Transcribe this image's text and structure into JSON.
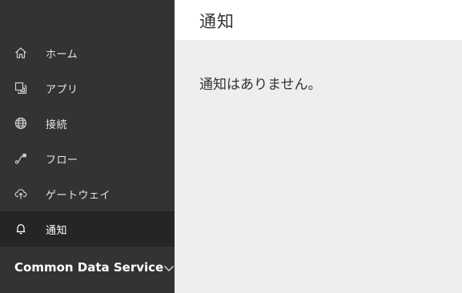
{
  "sidebar": {
    "items": [
      {
        "label": "ホーム",
        "icon": "home-icon"
      },
      {
        "label": "アプリ",
        "icon": "apps-icon"
      },
      {
        "label": "接続",
        "icon": "globe-icon"
      },
      {
        "label": "フロー",
        "icon": "flow-icon"
      },
      {
        "label": "ゲートウェイ",
        "icon": "cloud-upload-icon"
      },
      {
        "label": "通知",
        "icon": "bell-icon",
        "active": true
      }
    ],
    "environment": {
      "label": "Common Data Service",
      "icon": "chevron-down-icon"
    }
  },
  "header": {
    "title": "通知"
  },
  "main": {
    "empty_message": "通知はありません。"
  },
  "colors": {
    "sidebar_bg": "#333333",
    "sidebar_active_bg": "#252525",
    "content_bg": "#eeeeee",
    "header_bg": "#ffffff"
  }
}
